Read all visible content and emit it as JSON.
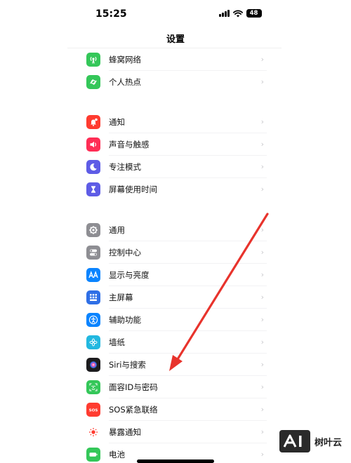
{
  "status_bar": {
    "time": "15:25",
    "battery": "48"
  },
  "nav": {
    "title": "设置"
  },
  "groups": [
    {
      "items": [
        {
          "label": "蜂窝网络",
          "icon": "cellular-antenna-icon",
          "color": "#34c759"
        },
        {
          "label": "个人热点",
          "icon": "personal-hotspot-icon",
          "color": "#34c759"
        }
      ]
    },
    {
      "items": [
        {
          "label": "通知",
          "icon": "notification-bell-icon",
          "color": "#ff3b30"
        },
        {
          "label": "声音与触感",
          "icon": "speaker-icon",
          "color": "#ff2d55"
        },
        {
          "label": "专注模式",
          "icon": "moon-icon",
          "color": "#5e5ce6"
        },
        {
          "label": "屏幕使用时间",
          "icon": "hourglass-icon",
          "color": "#5e5ce6"
        }
      ]
    },
    {
      "items": [
        {
          "label": "通用",
          "icon": "gear-icon",
          "color": "#8e8e93"
        },
        {
          "label": "控制中心",
          "icon": "toggles-icon",
          "color": "#8e8e93"
        },
        {
          "label": "显示与亮度",
          "icon": "aa-display-icon",
          "color": "#0a84ff"
        },
        {
          "label": "主屏幕",
          "icon": "home-grid-icon",
          "color": "#2f6fe6"
        },
        {
          "label": "辅助功能",
          "icon": "accessibility-icon",
          "color": "#0a84ff"
        },
        {
          "label": "墙纸",
          "icon": "wallpaper-flower-icon",
          "color": "#22b8e0"
        },
        {
          "label": "Siri与搜索",
          "icon": "siri-orb-icon",
          "color": "#1c1c1e"
        },
        {
          "label": "面容ID与密码",
          "icon": "face-id-icon",
          "color": "#34c759"
        },
        {
          "label": "SOS紧急联络",
          "icon": "sos-icon",
          "color": "#ff3b30"
        },
        {
          "label": "暴露通知",
          "icon": "exposure-notification-icon",
          "color": "#ffffff"
        },
        {
          "label": "电池",
          "icon": "battery-icon",
          "color": "#34c759"
        }
      ]
    }
  ],
  "chevron": "›",
  "annotation": {
    "arrow_color": "#e8332c"
  },
  "watermark": {
    "logo": "AI",
    "text": "树叶云"
  }
}
